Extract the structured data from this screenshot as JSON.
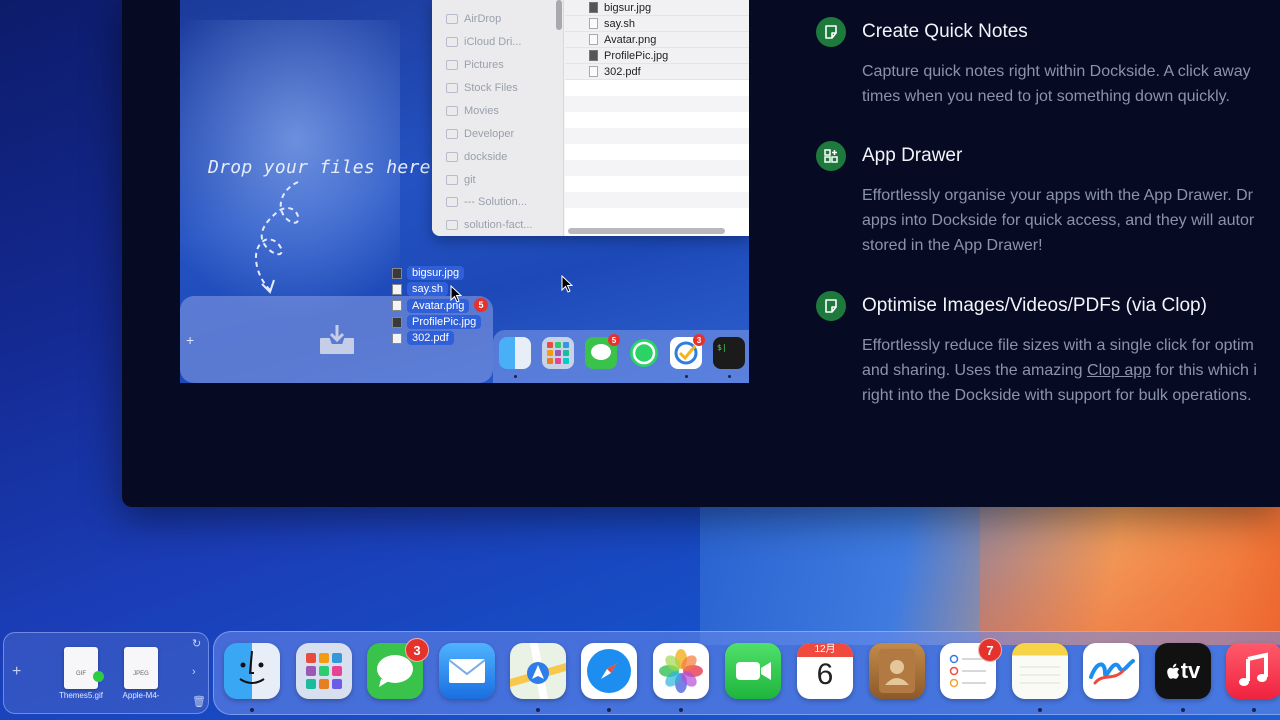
{
  "demo": {
    "drop_text": "Drop your files here",
    "sidebar_items": [
      "AirDrop",
      "iCloud Dri...",
      "Pictures",
      "Stock Files",
      "Movies",
      "Developer",
      "dockside",
      "git",
      "--- Solution...",
      "solution-fact..."
    ],
    "finder_files": [
      "bigsur.jpg",
      "say.sh",
      "Avatar.png",
      "ProfilePic.jpg",
      "302.pdf"
    ],
    "dragged_files": [
      "bigsur.jpg",
      "say.sh",
      "Avatar.png",
      "ProfilePic.jpg",
      "302.pdf"
    ],
    "dragged_count": "5",
    "mini_dock_badges": {
      "messages": "5",
      "tasks": "3"
    },
    "terminal_glyph": "$|"
  },
  "features": [
    {
      "title": "Create Quick Notes",
      "body_lines": [
        "Capture quick notes right within Dockside. A click away",
        "times when you need to jot something down quickly."
      ]
    },
    {
      "title": "App Drawer",
      "body_lines": [
        "Effortlessly organise your apps with the App Drawer. Dr",
        "apps into Dockside for quick access, and they will autor",
        "stored in the App Drawer!"
      ]
    },
    {
      "title": "Optimise Images/Videos/PDFs (via Clop)",
      "body_line1": "Effortlessly reduce file sizes with a single click for optim",
      "body_line2_pre": "and sharing. Uses the amazing ",
      "body_link": "Clop app",
      "body_line2_post": " for this which i",
      "body_line3": "right into the Dockside with support for bulk operations."
    }
  ],
  "shelf": {
    "plus": "+",
    "files": [
      {
        "type": "GIF",
        "name": "Themes5.gif"
      },
      {
        "type": "JPEG",
        "name": "Apple-M4-"
      }
    ]
  },
  "dock": {
    "badges": {
      "messages": "3",
      "reminders": "7"
    },
    "calendar_month": "12月",
    "calendar_day": "6",
    "tv_label": "tv"
  },
  "colors": {
    "feature_icon": "#1e7a3c",
    "badge": "#e5322d",
    "site_background": "#060b23"
  }
}
